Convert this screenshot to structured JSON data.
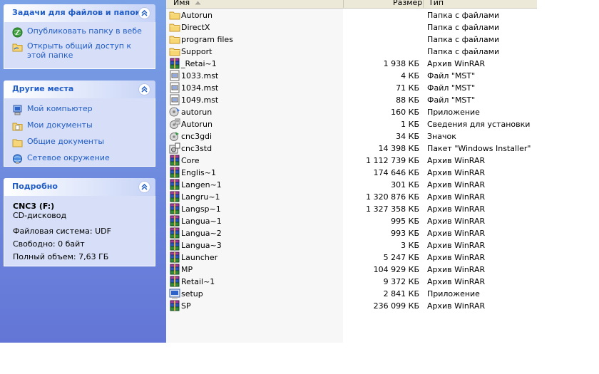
{
  "taskpane": {
    "tasks": {
      "title": "Задачи для файлов и папок",
      "items": [
        {
          "icon": "publish-web-icon",
          "label": "Опубликовать папку в вебе"
        },
        {
          "icon": "share-folder-icon",
          "label": "Открыть общий доступ к этой папке"
        }
      ]
    },
    "places": {
      "title": "Другие места",
      "items": [
        {
          "icon": "my-computer-icon",
          "label": "Мой компьютер"
        },
        {
          "icon": "my-documents-icon",
          "label": "Мои документы"
        },
        {
          "icon": "shared-documents-icon",
          "label": "Общие документы"
        },
        {
          "icon": "network-places-icon",
          "label": "Сетевое окружение"
        }
      ]
    },
    "details": {
      "title": "Подробно",
      "name": "CNC3 (F:)",
      "type": "CD-дисковод",
      "filesystem": "Файловая система: UDF",
      "free": "Свободно: 0 байт",
      "total": "Полный объем: 7,63 ГБ"
    }
  },
  "columns": {
    "name": "Имя",
    "size": "Размер",
    "type": "Тип"
  },
  "colors": {
    "pane_top": "#7ba2e7",
    "pane_bottom": "#6375d6",
    "link": "#215dc6",
    "panel_body": "#d6dff7"
  },
  "files": [
    {
      "icon": "folder",
      "name": "Autorun",
      "size": "",
      "type": "Папка с файлами"
    },
    {
      "icon": "folder",
      "name": "DirectX",
      "size": "",
      "type": "Папка с файлами"
    },
    {
      "icon": "folder",
      "name": "program files",
      "size": "",
      "type": "Папка с файлами"
    },
    {
      "icon": "folder",
      "name": "Support",
      "size": "",
      "type": "Папка с файлами"
    },
    {
      "icon": "winrar",
      "name": "_Retai~1",
      "size": "1 938 КБ",
      "type": "Архив WinRAR"
    },
    {
      "icon": "mst",
      "name": "1033.mst",
      "size": "4 КБ",
      "type": "Файл \"MST\""
    },
    {
      "icon": "mst",
      "name": "1034.mst",
      "size": "71 КБ",
      "type": "Файл \"MST\""
    },
    {
      "icon": "mst",
      "name": "1049.mst",
      "size": "88 КБ",
      "type": "Файл \"MST\""
    },
    {
      "icon": "app",
      "name": "autorun",
      "size": "160 КБ",
      "type": "Приложение"
    },
    {
      "icon": "inf",
      "name": "Autorun",
      "size": "1 КБ",
      "type": "Сведения для установки"
    },
    {
      "icon": "ico",
      "name": "cnc3gdi",
      "size": "34 КБ",
      "type": "Значок"
    },
    {
      "icon": "msi",
      "name": "cnc3std",
      "size": "14 398 КБ",
      "type": "Пакет \"Windows Installer\""
    },
    {
      "icon": "winrar",
      "name": "Core",
      "size": "1 112 739 КБ",
      "type": "Архив WinRAR"
    },
    {
      "icon": "winrar",
      "name": "Englis~1",
      "size": "174 646 КБ",
      "type": "Архив WinRAR"
    },
    {
      "icon": "winrar",
      "name": "Langen~1",
      "size": "301 КБ",
      "type": "Архив WinRAR"
    },
    {
      "icon": "winrar",
      "name": "Langru~1",
      "size": "1 320 876 КБ",
      "type": "Архив WinRAR"
    },
    {
      "icon": "winrar",
      "name": "Langsp~1",
      "size": "1 327 358 КБ",
      "type": "Архив WinRAR"
    },
    {
      "icon": "winrar",
      "name": "Langua~1",
      "size": "995 КБ",
      "type": "Архив WinRAR"
    },
    {
      "icon": "winrar",
      "name": "Langua~2",
      "size": "993 КБ",
      "type": "Архив WinRAR"
    },
    {
      "icon": "winrar",
      "name": "Langua~3",
      "size": "3 КБ",
      "type": "Архив WinRAR"
    },
    {
      "icon": "winrar",
      "name": "Launcher",
      "size": "5 247 КБ",
      "type": "Архив WinRAR"
    },
    {
      "icon": "winrar",
      "name": "MP",
      "size": "104 929 КБ",
      "type": "Архив WinRAR"
    },
    {
      "icon": "winrar",
      "name": "Retail~1",
      "size": "9 372 КБ",
      "type": "Архив WinRAR"
    },
    {
      "icon": "setup",
      "name": "setup",
      "size": "2 841 КБ",
      "type": "Приложение"
    },
    {
      "icon": "winrar",
      "name": "SP",
      "size": "236 099 КБ",
      "type": "Архив WinRAR"
    }
  ]
}
